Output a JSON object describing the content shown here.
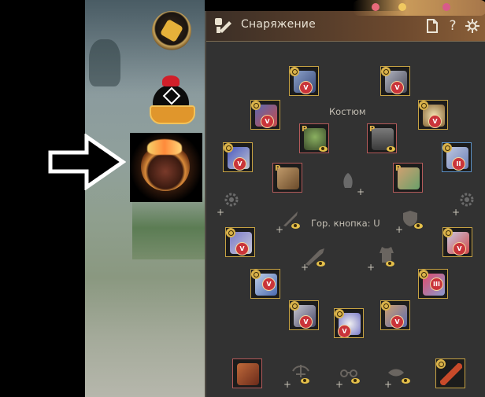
{
  "window": {
    "title": "Снаряжение",
    "buttons": {
      "doc_icon": "document-icon",
      "help_label": "?",
      "settings_icon": "gear-icon"
    }
  },
  "equipment": {
    "costume_label": "Костюм",
    "hotkey_label": "Гор. кнопка: U",
    "badges": {
      "p": "P",
      "v": "V",
      "ii": "II",
      "iii": "III"
    }
  },
  "left_hud": {
    "icons": [
      "quest-icon",
      "event-gift-icon",
      "black-spirit-bag-icon",
      "arrow-pointer-icon"
    ]
  },
  "colors": {
    "panel_bg": "#323232",
    "slot_gold": "#c6a243",
    "slot_red": "#b45a5a",
    "slot_blue": "#5a8fc4",
    "badge_red": "#c9343a"
  }
}
